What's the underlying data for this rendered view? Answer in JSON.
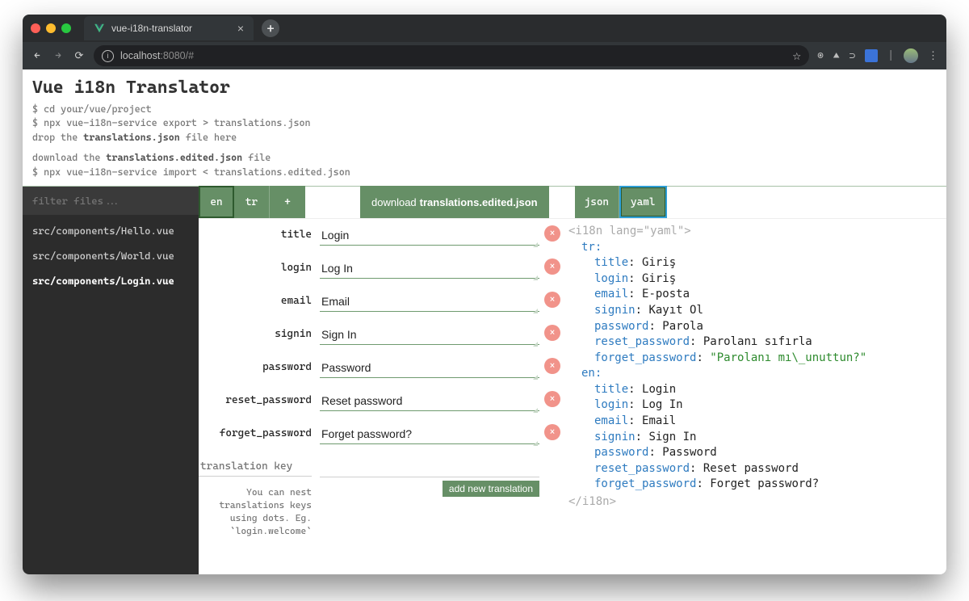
{
  "browser": {
    "tab_title": "vue-i18n-translator",
    "url_host": "localhost",
    "url_port": ":8080",
    "url_path": "/#"
  },
  "header": {
    "title": "Vue i18n Translator",
    "block1_l1": "$ cd your/vue/project",
    "block1_l2": "$ npx vue-i18n-service export > translations.json",
    "block1_l3_a": "drop the ",
    "block1_l3_b": "translations.json",
    "block1_l3_c": " file here",
    "block2_l1_a": "download the ",
    "block2_l1_b": "translations.edited.json",
    "block2_l1_c": " file",
    "block2_l2": "$ npx vue-i18n-service import < translations.edited.json"
  },
  "sidebar": {
    "filter_placeholder": "filter files...",
    "files": [
      {
        "label": "src/components/Hello.vue"
      },
      {
        "label": "src/components/World.vue"
      },
      {
        "label": "src/components/Login.vue"
      }
    ],
    "active_index": 2
  },
  "toolbar": {
    "langs": [
      "en",
      "tr"
    ],
    "add_lang": "+",
    "active_lang_index": 0,
    "download_prefix": "download ",
    "download_file": "translations.edited.json",
    "formats": [
      "json",
      "yaml"
    ],
    "active_format_index": 1
  },
  "translations": [
    {
      "key": "title",
      "value": "Login"
    },
    {
      "key": "login",
      "value": "Log In"
    },
    {
      "key": "email",
      "value": "Email"
    },
    {
      "key": "signin",
      "value": "Sign In"
    },
    {
      "key": "password",
      "value": "Password"
    },
    {
      "key": "reset_password",
      "value": "Reset password"
    },
    {
      "key": "forget_password",
      "value": "Forget password?"
    }
  ],
  "newkey_placeholder": "translation key",
  "hint_l1": "You can nest",
  "hint_l2": "translations keys",
  "hint_l3": "using dots. Eg.",
  "hint_l4": "`login.welcome`",
  "add_btn": "add new translation",
  "yaml": {
    "open_tag": "<i18n lang=\"yaml\">",
    "close_tag": "</i18n>",
    "tr_label": "tr:",
    "en_label": "en:",
    "tr": {
      "title": "Giriş",
      "login": "Giriş",
      "email": "E-posta",
      "signin": "Kayıt Ol",
      "password": "Parola",
      "reset_password": "Parolanı sıfırla",
      "forget_password": "\"Parolanı mı\\_unuttun?\""
    },
    "en": {
      "title": "Login",
      "login": "Log In",
      "email": "Email",
      "signin": "Sign In",
      "password": "Password",
      "reset_password": "Reset password",
      "forget_password": "Forget password?"
    }
  }
}
